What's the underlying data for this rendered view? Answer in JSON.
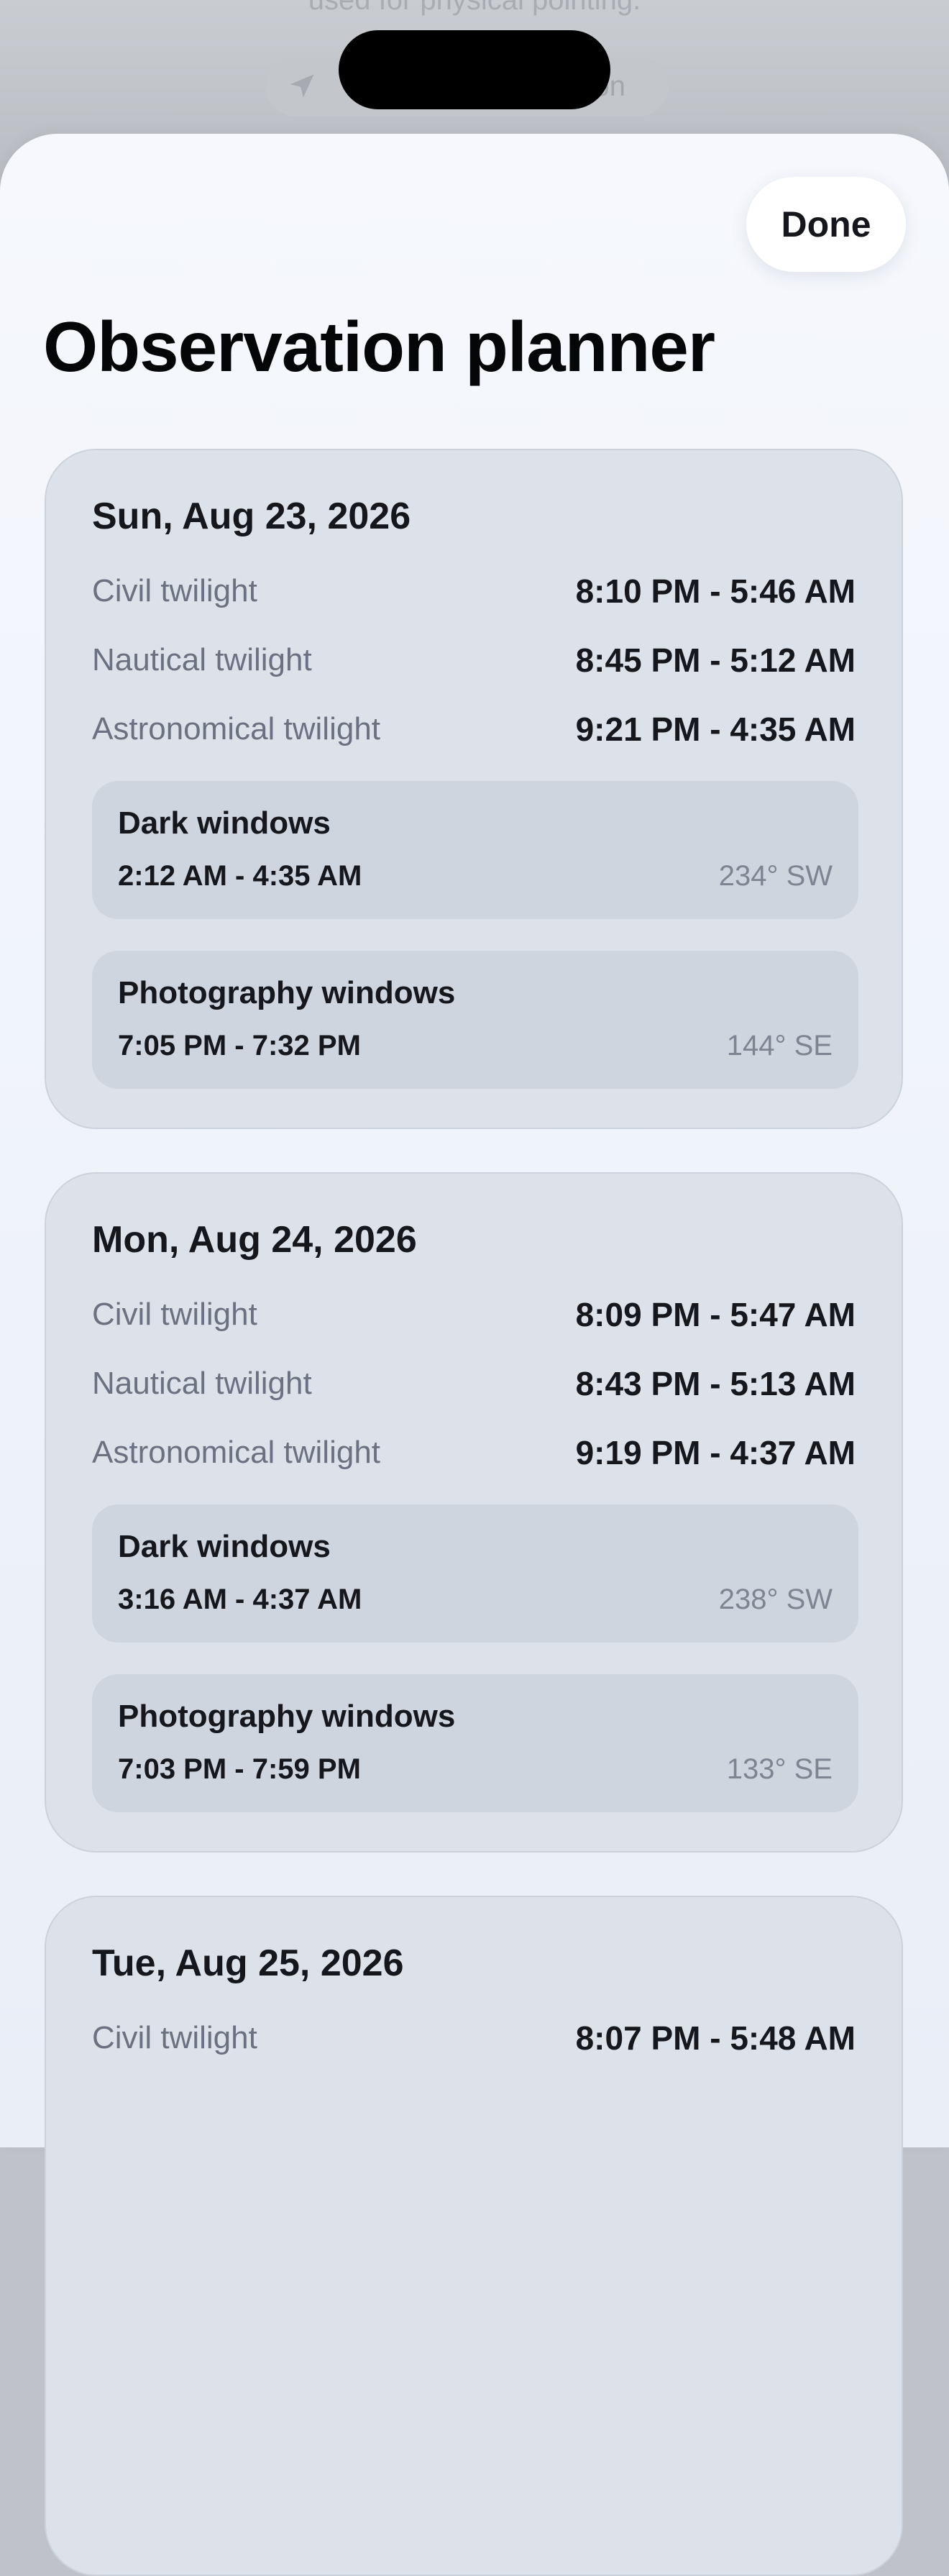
{
  "background": {
    "text": "used for physical pointing.",
    "button_label": "tion",
    "button_icon": "location-arrow-icon"
  },
  "sheet": {
    "done_label": "Done",
    "title": "Observation planner"
  },
  "days": [
    {
      "date": "Sun, Aug 23, 2026",
      "twilights": [
        {
          "label": "Civil twilight",
          "value": "8:10 PM - 5:46 AM"
        },
        {
          "label": "Nautical twilight",
          "value": "8:45 PM - 5:12 AM"
        },
        {
          "label": "Astronomical twilight",
          "value": "9:21 PM - 4:35 AM"
        }
      ],
      "windows": [
        {
          "title": "Dark windows",
          "time": "2:12 AM - 4:35 AM",
          "direction": "234° SW"
        },
        {
          "title": "Photography windows",
          "time": "7:05 PM - 7:32 PM",
          "direction": "144° SE"
        }
      ]
    },
    {
      "date": "Mon, Aug 24, 2026",
      "twilights": [
        {
          "label": "Civil twilight",
          "value": "8:09 PM - 5:47 AM"
        },
        {
          "label": "Nautical twilight",
          "value": "8:43 PM - 5:13 AM"
        },
        {
          "label": "Astronomical twilight",
          "value": "9:19 PM - 4:37 AM"
        }
      ],
      "windows": [
        {
          "title": "Dark windows",
          "time": "3:16 AM - 4:37 AM",
          "direction": "238° SW"
        },
        {
          "title": "Photography windows",
          "time": "7:03 PM - 7:59 PM",
          "direction": "133° SE"
        }
      ]
    },
    {
      "date": "Tue, Aug 25, 2026",
      "twilights": [
        {
          "label": "Civil twilight",
          "value": "8:07 PM - 5:48 AM"
        }
      ],
      "windows": []
    }
  ]
}
